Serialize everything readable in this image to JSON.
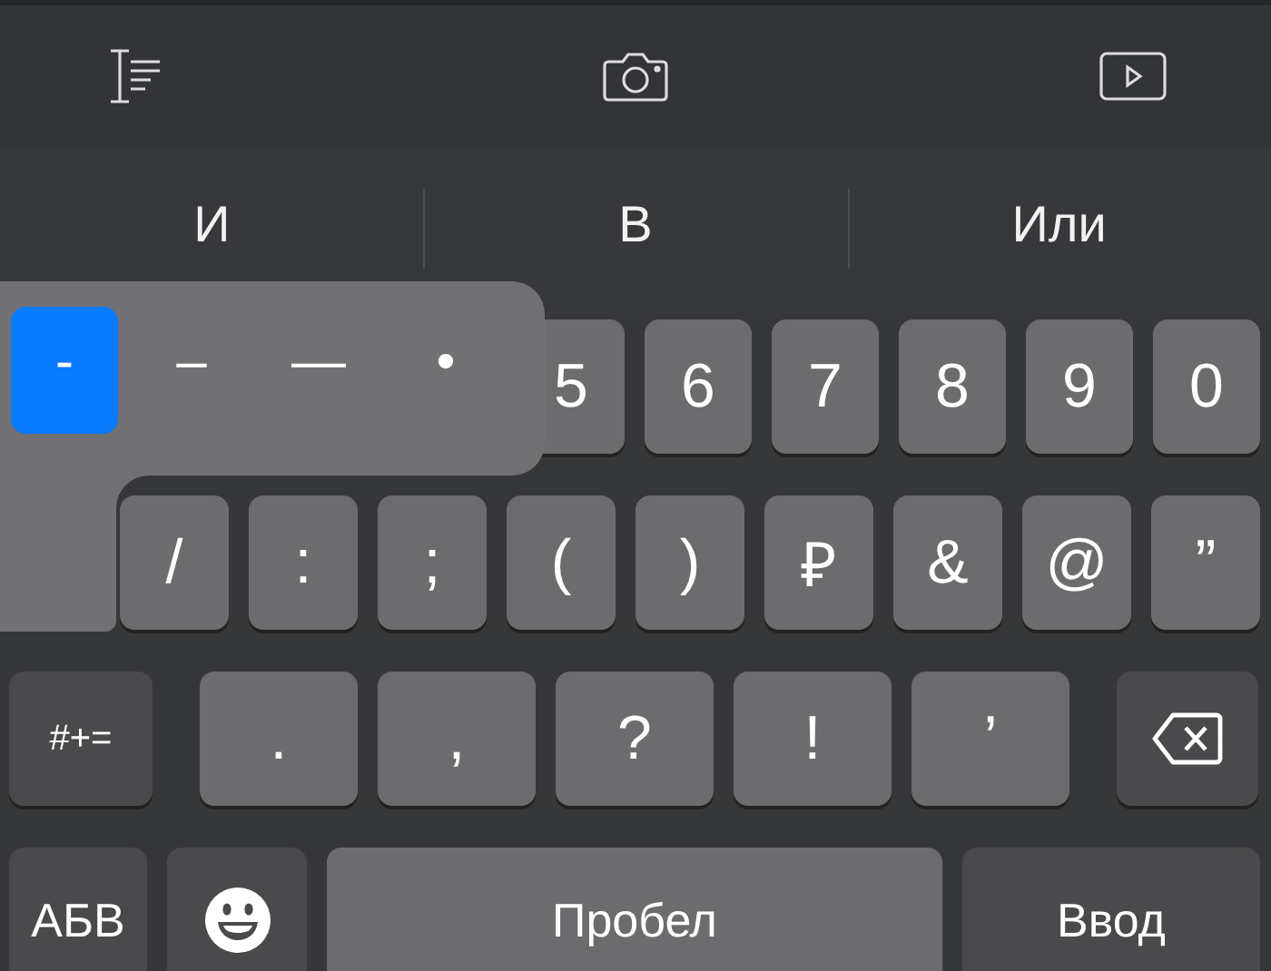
{
  "suggestions": [
    {
      "text": "И"
    },
    {
      "text": "В"
    },
    {
      "text": "Или"
    }
  ],
  "popup": {
    "options": [
      {
        "label": "-",
        "selected": true
      },
      {
        "label": "–",
        "selected": false
      },
      {
        "label": "—",
        "selected": false
      },
      {
        "label": "•",
        "selected": false
      }
    ]
  },
  "rows": [
    {
      "keys": [
        {
          "label": "5",
          "kind": "char"
        },
        {
          "label": "6",
          "kind": "char"
        },
        {
          "label": "7",
          "kind": "char"
        },
        {
          "label": "8",
          "kind": "char"
        },
        {
          "label": "9",
          "kind": "char"
        },
        {
          "label": "0",
          "kind": "char"
        }
      ]
    },
    {
      "keys": [
        {
          "label": "/",
          "kind": "char"
        },
        {
          "label": ":",
          "kind": "char"
        },
        {
          "label": ";",
          "kind": "char"
        },
        {
          "label": "(",
          "kind": "char"
        },
        {
          "label": ")",
          "kind": "char"
        },
        {
          "label": "₽",
          "kind": "char"
        },
        {
          "label": "&",
          "kind": "char"
        },
        {
          "label": "@",
          "kind": "char"
        },
        {
          "label": "”",
          "kind": "char"
        }
      ]
    },
    {
      "keys": [
        {
          "label": "#+=",
          "kind": "mode"
        },
        {
          "label": ".",
          "kind": "char"
        },
        {
          "label": ",",
          "kind": "char"
        },
        {
          "label": "?",
          "kind": "char"
        },
        {
          "label": "!",
          "kind": "char"
        },
        {
          "label": "’",
          "kind": "char"
        },
        {
          "kind": "delete"
        }
      ]
    },
    {
      "keys": [
        {
          "label": "АБВ",
          "kind": "mode"
        },
        {
          "kind": "emoji"
        },
        {
          "label": "Пробел",
          "kind": "space"
        },
        {
          "label": "Ввод",
          "kind": "mode"
        }
      ]
    }
  ]
}
